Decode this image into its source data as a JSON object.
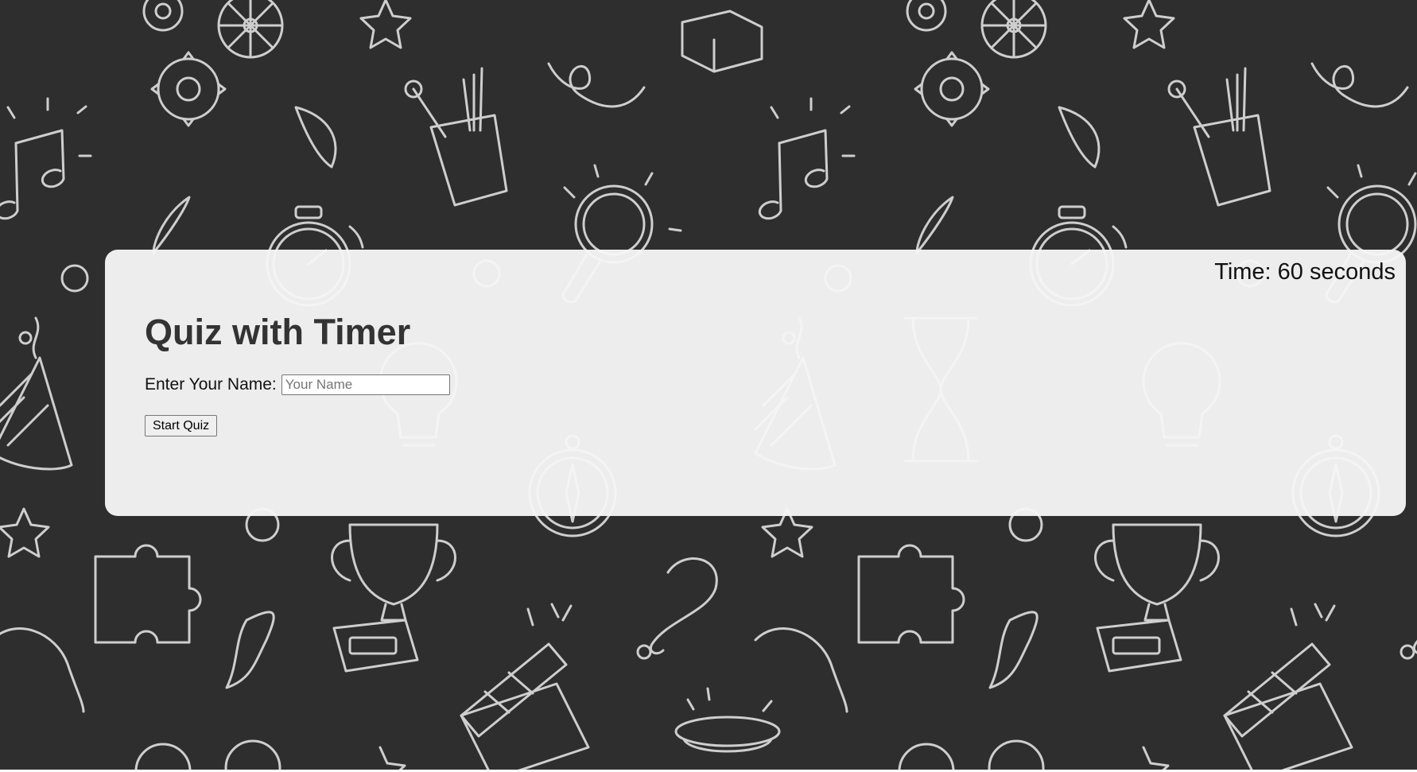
{
  "background": {
    "color": "#2e2e2e",
    "pattern": "doodle-line-art",
    "icons": [
      "gear-icon",
      "music-note-icon",
      "pencil-cup-icon",
      "magnifier-icon",
      "stopwatch-icon",
      "party-hat-icon",
      "lightbulb-icon",
      "hourglass-icon",
      "compass-icon",
      "trophy-icon",
      "puzzle-icon",
      "question-mark-icon",
      "star-icon",
      "clapperboard-icon",
      "ribbon-icon"
    ]
  },
  "quiz": {
    "timer_text": "Time: 60 seconds",
    "title": "Quiz with Timer",
    "name_label": "Enter Your Name:",
    "name_placeholder": "Your Name",
    "name_value": "",
    "start_button_label": "Start Quiz"
  },
  "colors": {
    "card": "#f6f6f6",
    "title": "#333333",
    "text": "#111111"
  }
}
